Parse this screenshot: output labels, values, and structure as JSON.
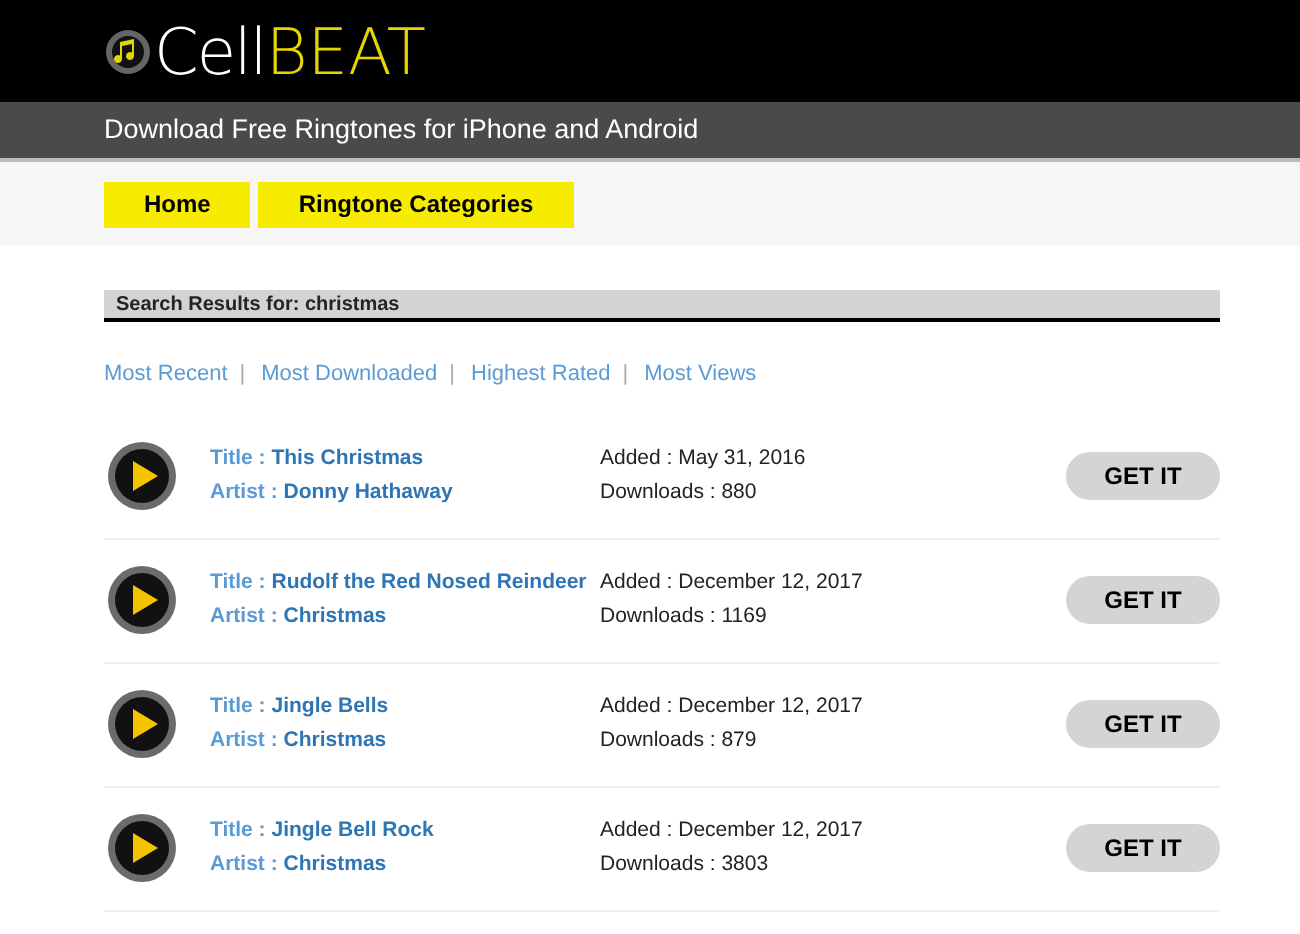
{
  "logo": {
    "part_1": "Cell",
    "part_2": "BEAT"
  },
  "tagline": "Download Free Ringtones for iPhone and Android",
  "nav": [
    {
      "label": "Home"
    },
    {
      "label": "Ringtone Categories"
    }
  ],
  "search_heading": "Search Results for: christmas",
  "sort_links": [
    {
      "label": "Most Recent",
      "separator": "|"
    },
    {
      "label": "Most Downloaded",
      "separator": "|"
    },
    {
      "label": "Highest Rated",
      "separator": "|"
    },
    {
      "label": "Most Views"
    }
  ],
  "results": [
    {
      "title_label": "Title :",
      "title": "This Christmas",
      "artist_label": "Artist :",
      "artist": "Donny Hathaway",
      "added": "Added : May 31, 2016",
      "downloads": "Downloads : 880",
      "button": "GET IT"
    },
    {
      "title_label": "Title :",
      "title": "Rudolf the Red Nosed Reindeer",
      "artist_label": "Artist :",
      "artist": "Christmas",
      "added": "Added : December 12, 2017",
      "downloads": "Downloads : 1169",
      "button": "GET IT"
    },
    {
      "title_label": "Title :",
      "title": "Jingle Bells",
      "artist_label": "Artist :",
      "artist": "Christmas",
      "added": "Added : December 12, 2017",
      "downloads": "Downloads : 879",
      "button": "GET IT"
    },
    {
      "title_label": "Title :",
      "title": "Jingle Bell Rock",
      "artist_label": "Artist :",
      "artist": "Christmas",
      "added": "Added : December 12, 2017",
      "downloads": "Downloads : 3803",
      "button": "GET IT"
    }
  ]
}
